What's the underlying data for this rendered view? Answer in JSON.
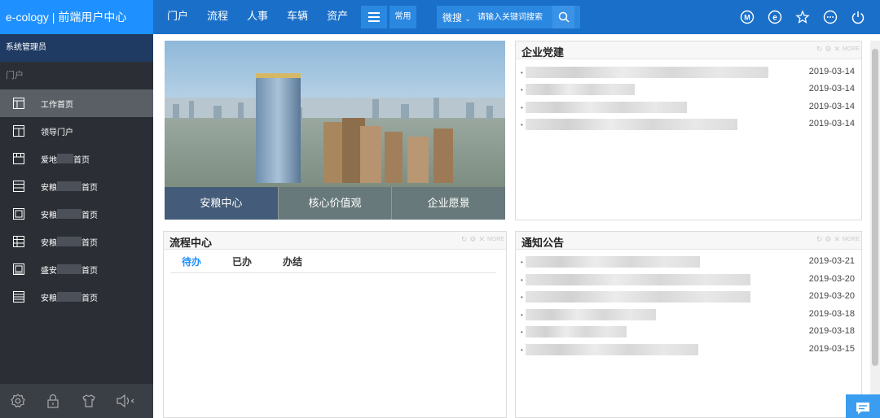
{
  "brand": "e-cology | 前端用户中心",
  "nav": [
    "门户",
    "流程",
    "人事",
    "车辆",
    "资产"
  ],
  "common_label": "常用",
  "search": {
    "scope": "微搜",
    "placeholder": "请输入关键词搜索"
  },
  "sidebar": {
    "admin": "系统管理员",
    "section": "门户",
    "items": [
      {
        "label": "工作首页",
        "suffix": ""
      },
      {
        "label": "领导门户",
        "suffix": ""
      },
      {
        "label": "爱地",
        "suffix": "首页"
      },
      {
        "label": "安粮",
        "suffix": "首页"
      },
      {
        "label": "安粮",
        "suffix": "首页"
      },
      {
        "label": "安粮",
        "suffix": "首页"
      },
      {
        "label": "盛安",
        "suffix": "首页"
      },
      {
        "label": "安粮",
        "suffix": "首页"
      }
    ]
  },
  "banner": {
    "tabs": [
      "安粮中心",
      "核心价值观",
      "企业愿景"
    ]
  },
  "party": {
    "title": "企业党建",
    "tools_label": "MORE",
    "dates": [
      "2019-03-14",
      "2019-03-14",
      "2019-03-14",
      "2019-03-14"
    ]
  },
  "workflow": {
    "title": "流程中心",
    "tools_label": "MORE",
    "tabs": [
      "待办",
      "已办",
      "办结"
    ]
  },
  "notice": {
    "title": "通知公告",
    "tools_label": "MORE",
    "dates": [
      "2019-03-21",
      "2019-03-20",
      "2019-03-20",
      "2019-03-18",
      "2019-03-18",
      "2019-03-15"
    ]
  },
  "colors": {
    "topbar": "#1a6fc9",
    "brand_bg": "#1e90ff",
    "sidebar": "#2b2f35",
    "accent": "#1e90ff"
  }
}
